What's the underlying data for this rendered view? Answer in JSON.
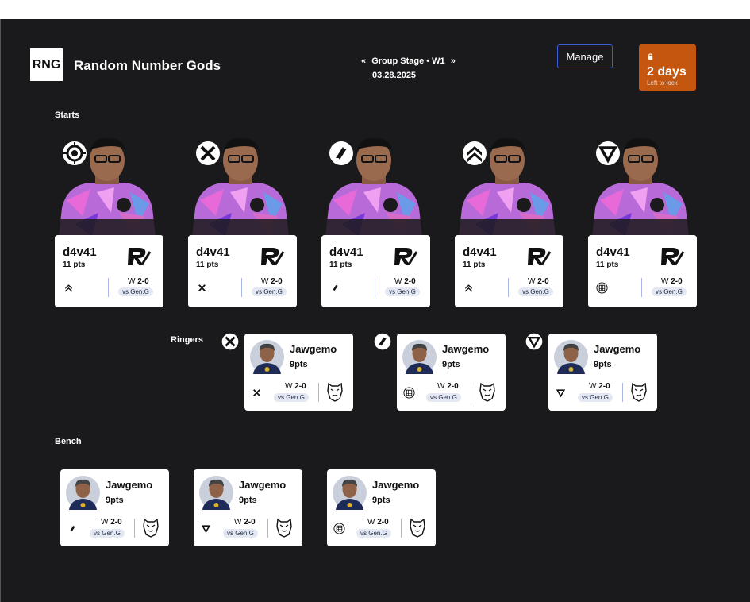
{
  "header": {
    "logo_text": "RNG",
    "team_name": "Random Number Gods",
    "prev_arrow": "«",
    "stage": "Group Stage • W1",
    "next_arrow": "»",
    "date": "03.28.2025",
    "manage_label": "Manage",
    "lock_days": "2 days",
    "lock_sub": "Left to lock"
  },
  "colors": {
    "background": "#1a191c",
    "lock": "#c4560f",
    "manage_border": "#3a5fd9",
    "card": "#ffffff"
  },
  "sections": {
    "starts": "Starts",
    "ringers": "Ringers",
    "bench": "Bench"
  },
  "starters": [
    {
      "role_icon": "top-icon",
      "name": "d4v41",
      "pts": "11 pts",
      "mini_role_icon": "support-icon",
      "result_prefix": "W",
      "result": "2-0",
      "vs": "vs Gen.G"
    },
    {
      "role_icon": "jungle-icon",
      "name": "d4v41",
      "pts": "11 pts",
      "mini_role_icon": "jungle-icon",
      "result_prefix": "W",
      "result": "2-0",
      "vs": "vs Gen.G"
    },
    {
      "role_icon": "mid-icon",
      "name": "d4v41",
      "pts": "11 pts",
      "mini_role_icon": "mid-icon",
      "result_prefix": "W",
      "result": "2-0",
      "vs": "vs Gen.G"
    },
    {
      "role_icon": "support-icon",
      "name": "d4v41",
      "pts": "11 pts",
      "mini_role_icon": "support-icon",
      "result_prefix": "W",
      "result": "2-0",
      "vs": "vs Gen.G"
    },
    {
      "role_icon": "bot-icon",
      "name": "d4v41",
      "pts": "11 pts",
      "mini_role_icon": "team-icon",
      "result_prefix": "W",
      "result": "2-0",
      "vs": "vs Gen.G"
    }
  ],
  "ringers": [
    {
      "role_icon": "jungle-icon",
      "name": "Jawgemo",
      "pts": "9pts",
      "mini_role_icon": "jungle-icon",
      "result_prefix": "W",
      "result": "2-0",
      "vs": "vs Gen.G"
    },
    {
      "role_icon": "mid-icon",
      "name": "Jawgemo",
      "pts": "9pts",
      "mini_role_icon": "team-icon",
      "result_prefix": "W",
      "result": "2-0",
      "vs": "vs Gen.G"
    },
    {
      "role_icon": "bot-icon",
      "name": "Jawgemo",
      "pts": "9pts",
      "mini_role_icon": "bot-icon",
      "result_prefix": "W",
      "result": "2-0",
      "vs": "vs Gen.G"
    }
  ],
  "bench": [
    {
      "name": "Jawgemo",
      "pts": "9pts",
      "mini_role_icon": "mid-icon",
      "result_prefix": "W",
      "result": "2-0",
      "vs": "vs Gen.G"
    },
    {
      "name": "Jawgemo",
      "pts": "9pts",
      "mini_role_icon": "bot-icon",
      "result_prefix": "W",
      "result": "2-0",
      "vs": "vs Gen.G"
    },
    {
      "name": "Jawgemo",
      "pts": "9pts",
      "mini_role_icon": "team-icon",
      "result_prefix": "W",
      "result": "2-0",
      "vs": "vs Gen.G"
    }
  ]
}
